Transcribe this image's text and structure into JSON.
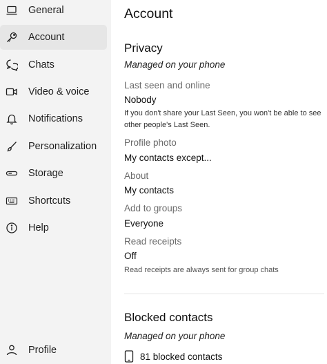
{
  "sidebar": {
    "items": [
      {
        "label": "General",
        "icon": "laptop-icon"
      },
      {
        "label": "Account",
        "icon": "key-icon",
        "selected": true
      },
      {
        "label": "Chats",
        "icon": "chat-bubbles-icon"
      },
      {
        "label": "Video & voice",
        "icon": "video-camera-icon"
      },
      {
        "label": "Notifications",
        "icon": "bell-icon"
      },
      {
        "label": "Personalization",
        "icon": "brush-icon"
      },
      {
        "label": "Storage",
        "icon": "storage-icon"
      },
      {
        "label": "Shortcuts",
        "icon": "keyboard-icon"
      },
      {
        "label": "Help",
        "icon": "info-icon"
      }
    ],
    "profile": {
      "label": "Profile",
      "icon": "person-icon"
    }
  },
  "main": {
    "title": "Account",
    "privacy": {
      "heading": "Privacy",
      "managed": "Managed on your phone",
      "last_seen": {
        "label": "Last seen and online",
        "value": "Nobody",
        "note": "If you don't share your Last Seen, you won't be able to see other people's Last Seen."
      },
      "profile_photo": {
        "label": "Profile photo",
        "value": "My contacts except..."
      },
      "about": {
        "label": "About",
        "value": "My contacts"
      },
      "groups": {
        "label": "Add to groups",
        "value": "Everyone"
      },
      "read_receipts": {
        "label": "Read receipts",
        "value": "Off",
        "note": "Read receipts are always sent for group chats"
      }
    },
    "blocked": {
      "heading": "Blocked contacts",
      "managed": "Managed on your phone",
      "count_label": "81 blocked contacts",
      "icon": "phone-icon"
    }
  }
}
